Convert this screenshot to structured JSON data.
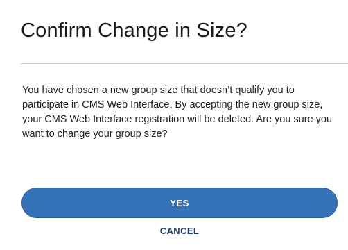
{
  "dialog": {
    "title": "Confirm Change in Size?",
    "message": "You have chosen a new group size that doesn’t qualify you to participate in CMS Web Interface. By accepting the new group size, your CMS Web Interface registration will be deleted. Are you sure you want to change your group size?",
    "confirm_label": "YES",
    "cancel_label": "CANCEL"
  },
  "colors": {
    "primary_button": "#3572b8",
    "primary_button_border": "#26588c",
    "cancel_link": "#1b3a6b",
    "divider": "#cfcfcf"
  }
}
